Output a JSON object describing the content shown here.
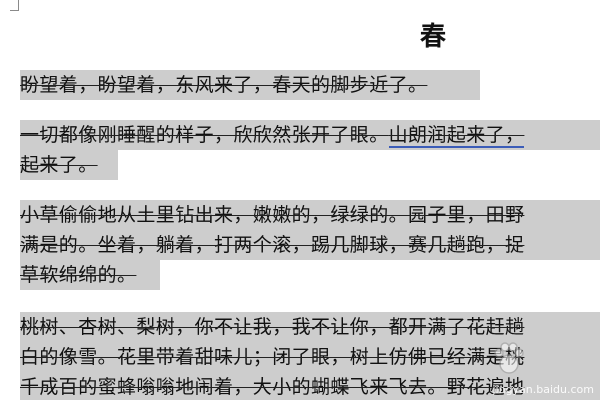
{
  "document": {
    "title": "春",
    "lines": [
      "盼望着，盼望着，东风来了，春天的脚步近了。",
      "一切都像刚睡醒的样子，欣欣然张开了眼。",
      "山朗润起来了，",
      "起来了。",
      "小草偷偷地从土里钻出来，嫩嫩的，绿绿的。园子里，田野",
      "满是的。坐着，躺着，打两个滚，踢几脚球，赛几趟跑，捉",
      "草软绵绵的。",
      "桃树、杏树、梨树，你不让我，我不让你，都开满了花赶趟",
      "白的像雪。花里带着甜味儿；闭了眼，树上仿佛已经满是桃",
      "千成百的蜜蜂嗡嗡地闹着，大小的蝴蝶飞来飞去。野花遍地"
    ]
  },
  "watermark": {
    "text": "jingyan.baidu.com",
    "icon": "baidu-paw-icon"
  },
  "colors": {
    "selection_highlight": "#cdcdcd",
    "text": "#111111",
    "grammar_underline": "#3b5cb8"
  }
}
